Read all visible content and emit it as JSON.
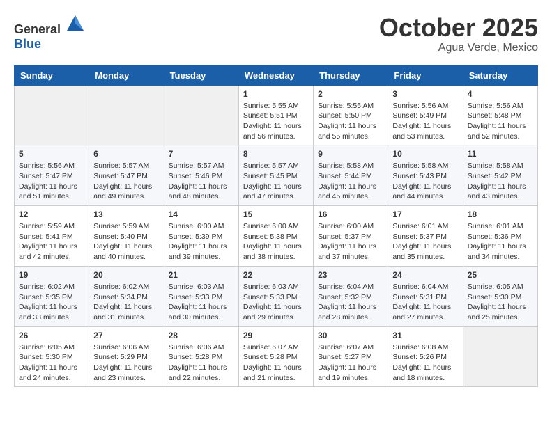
{
  "header": {
    "logo": {
      "general": "General",
      "blue": "Blue"
    },
    "title": "October 2025",
    "subtitle": "Agua Verde, Mexico"
  },
  "calendar": {
    "weekdays": [
      "Sunday",
      "Monday",
      "Tuesday",
      "Wednesday",
      "Thursday",
      "Friday",
      "Saturday"
    ],
    "weeks": [
      [
        {
          "day": "",
          "info": ""
        },
        {
          "day": "",
          "info": ""
        },
        {
          "day": "",
          "info": ""
        },
        {
          "day": "1",
          "info": "Sunrise: 5:55 AM\nSunset: 5:51 PM\nDaylight: 11 hours\nand 56 minutes."
        },
        {
          "day": "2",
          "info": "Sunrise: 5:55 AM\nSunset: 5:50 PM\nDaylight: 11 hours\nand 55 minutes."
        },
        {
          "day": "3",
          "info": "Sunrise: 5:56 AM\nSunset: 5:49 PM\nDaylight: 11 hours\nand 53 minutes."
        },
        {
          "day": "4",
          "info": "Sunrise: 5:56 AM\nSunset: 5:48 PM\nDaylight: 11 hours\nand 52 minutes."
        }
      ],
      [
        {
          "day": "5",
          "info": "Sunrise: 5:56 AM\nSunset: 5:47 PM\nDaylight: 11 hours\nand 51 minutes."
        },
        {
          "day": "6",
          "info": "Sunrise: 5:57 AM\nSunset: 5:47 PM\nDaylight: 11 hours\nand 49 minutes."
        },
        {
          "day": "7",
          "info": "Sunrise: 5:57 AM\nSunset: 5:46 PM\nDaylight: 11 hours\nand 48 minutes."
        },
        {
          "day": "8",
          "info": "Sunrise: 5:57 AM\nSunset: 5:45 PM\nDaylight: 11 hours\nand 47 minutes."
        },
        {
          "day": "9",
          "info": "Sunrise: 5:58 AM\nSunset: 5:44 PM\nDaylight: 11 hours\nand 45 minutes."
        },
        {
          "day": "10",
          "info": "Sunrise: 5:58 AM\nSunset: 5:43 PM\nDaylight: 11 hours\nand 44 minutes."
        },
        {
          "day": "11",
          "info": "Sunrise: 5:58 AM\nSunset: 5:42 PM\nDaylight: 11 hours\nand 43 minutes."
        }
      ],
      [
        {
          "day": "12",
          "info": "Sunrise: 5:59 AM\nSunset: 5:41 PM\nDaylight: 11 hours\nand 42 minutes."
        },
        {
          "day": "13",
          "info": "Sunrise: 5:59 AM\nSunset: 5:40 PM\nDaylight: 11 hours\nand 40 minutes."
        },
        {
          "day": "14",
          "info": "Sunrise: 6:00 AM\nSunset: 5:39 PM\nDaylight: 11 hours\nand 39 minutes."
        },
        {
          "day": "15",
          "info": "Sunrise: 6:00 AM\nSunset: 5:38 PM\nDaylight: 11 hours\nand 38 minutes."
        },
        {
          "day": "16",
          "info": "Sunrise: 6:00 AM\nSunset: 5:37 PM\nDaylight: 11 hours\nand 37 minutes."
        },
        {
          "day": "17",
          "info": "Sunrise: 6:01 AM\nSunset: 5:37 PM\nDaylight: 11 hours\nand 35 minutes."
        },
        {
          "day": "18",
          "info": "Sunrise: 6:01 AM\nSunset: 5:36 PM\nDaylight: 11 hours\nand 34 minutes."
        }
      ],
      [
        {
          "day": "19",
          "info": "Sunrise: 6:02 AM\nSunset: 5:35 PM\nDaylight: 11 hours\nand 33 minutes."
        },
        {
          "day": "20",
          "info": "Sunrise: 6:02 AM\nSunset: 5:34 PM\nDaylight: 11 hours\nand 31 minutes."
        },
        {
          "day": "21",
          "info": "Sunrise: 6:03 AM\nSunset: 5:33 PM\nDaylight: 11 hours\nand 30 minutes."
        },
        {
          "day": "22",
          "info": "Sunrise: 6:03 AM\nSunset: 5:33 PM\nDaylight: 11 hours\nand 29 minutes."
        },
        {
          "day": "23",
          "info": "Sunrise: 6:04 AM\nSunset: 5:32 PM\nDaylight: 11 hours\nand 28 minutes."
        },
        {
          "day": "24",
          "info": "Sunrise: 6:04 AM\nSunset: 5:31 PM\nDaylight: 11 hours\nand 27 minutes."
        },
        {
          "day": "25",
          "info": "Sunrise: 6:05 AM\nSunset: 5:30 PM\nDaylight: 11 hours\nand 25 minutes."
        }
      ],
      [
        {
          "day": "26",
          "info": "Sunrise: 6:05 AM\nSunset: 5:30 PM\nDaylight: 11 hours\nand 24 minutes."
        },
        {
          "day": "27",
          "info": "Sunrise: 6:06 AM\nSunset: 5:29 PM\nDaylight: 11 hours\nand 23 minutes."
        },
        {
          "day": "28",
          "info": "Sunrise: 6:06 AM\nSunset: 5:28 PM\nDaylight: 11 hours\nand 22 minutes."
        },
        {
          "day": "29",
          "info": "Sunrise: 6:07 AM\nSunset: 5:28 PM\nDaylight: 11 hours\nand 21 minutes."
        },
        {
          "day": "30",
          "info": "Sunrise: 6:07 AM\nSunset: 5:27 PM\nDaylight: 11 hours\nand 19 minutes."
        },
        {
          "day": "31",
          "info": "Sunrise: 6:08 AM\nSunset: 5:26 PM\nDaylight: 11 hours\nand 18 minutes."
        },
        {
          "day": "",
          "info": ""
        }
      ]
    ]
  }
}
